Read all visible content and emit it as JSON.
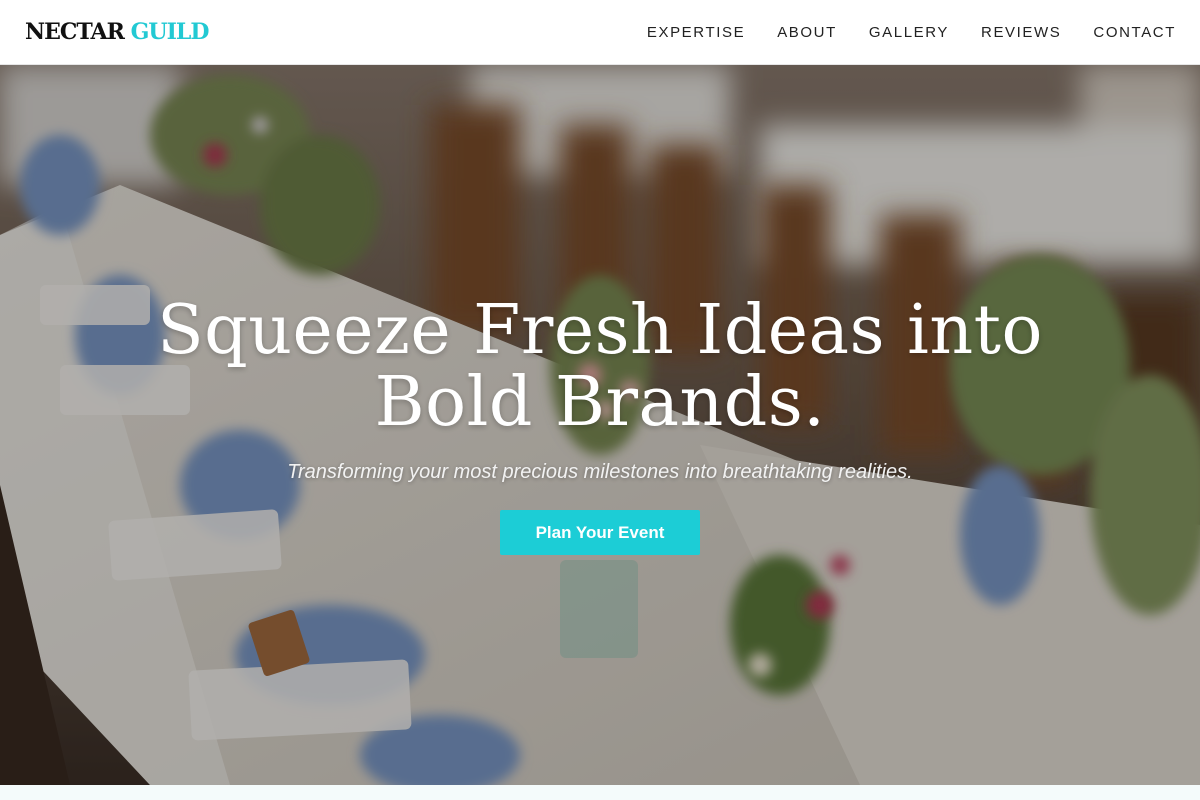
{
  "header": {
    "logo_primary": "NECTAR",
    "logo_accent": "GUILD",
    "nav": [
      {
        "label": "EXPERTISE"
      },
      {
        "label": "ABOUT"
      },
      {
        "label": "GALLERY"
      },
      {
        "label": "REVIEWS"
      },
      {
        "label": "CONTACT"
      }
    ]
  },
  "hero": {
    "title_line1": "Squeeze Fresh Ideas into",
    "title_line2": "Bold Brands.",
    "subtitle": "Transforming your most precious milestones into breathtaking realities.",
    "cta_label": "Plan Your Event"
  },
  "colors": {
    "accent": "#22c9d3",
    "button": "#1ccdd6",
    "nav_text": "#222222",
    "logo_text": "#111111"
  }
}
